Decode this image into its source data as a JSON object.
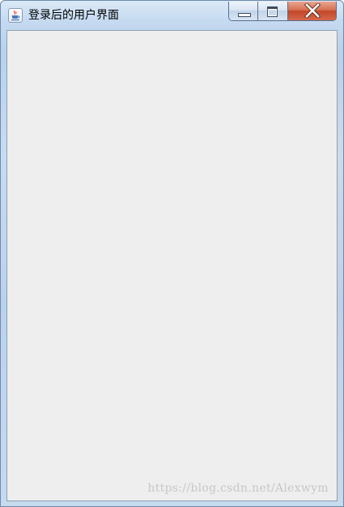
{
  "window": {
    "title": "登录后的用户界面",
    "icon": "java-cup-icon",
    "controls": {
      "minimize": "minimize-icon",
      "maximize": "maximize-icon",
      "close": "close-icon"
    }
  },
  "watermark": {
    "text": "https://blog.csdn.net/Alexwym"
  },
  "colors": {
    "client_background": "#eeeeee",
    "close_button": "#c2462a",
    "frame": "#bcd2ea"
  }
}
